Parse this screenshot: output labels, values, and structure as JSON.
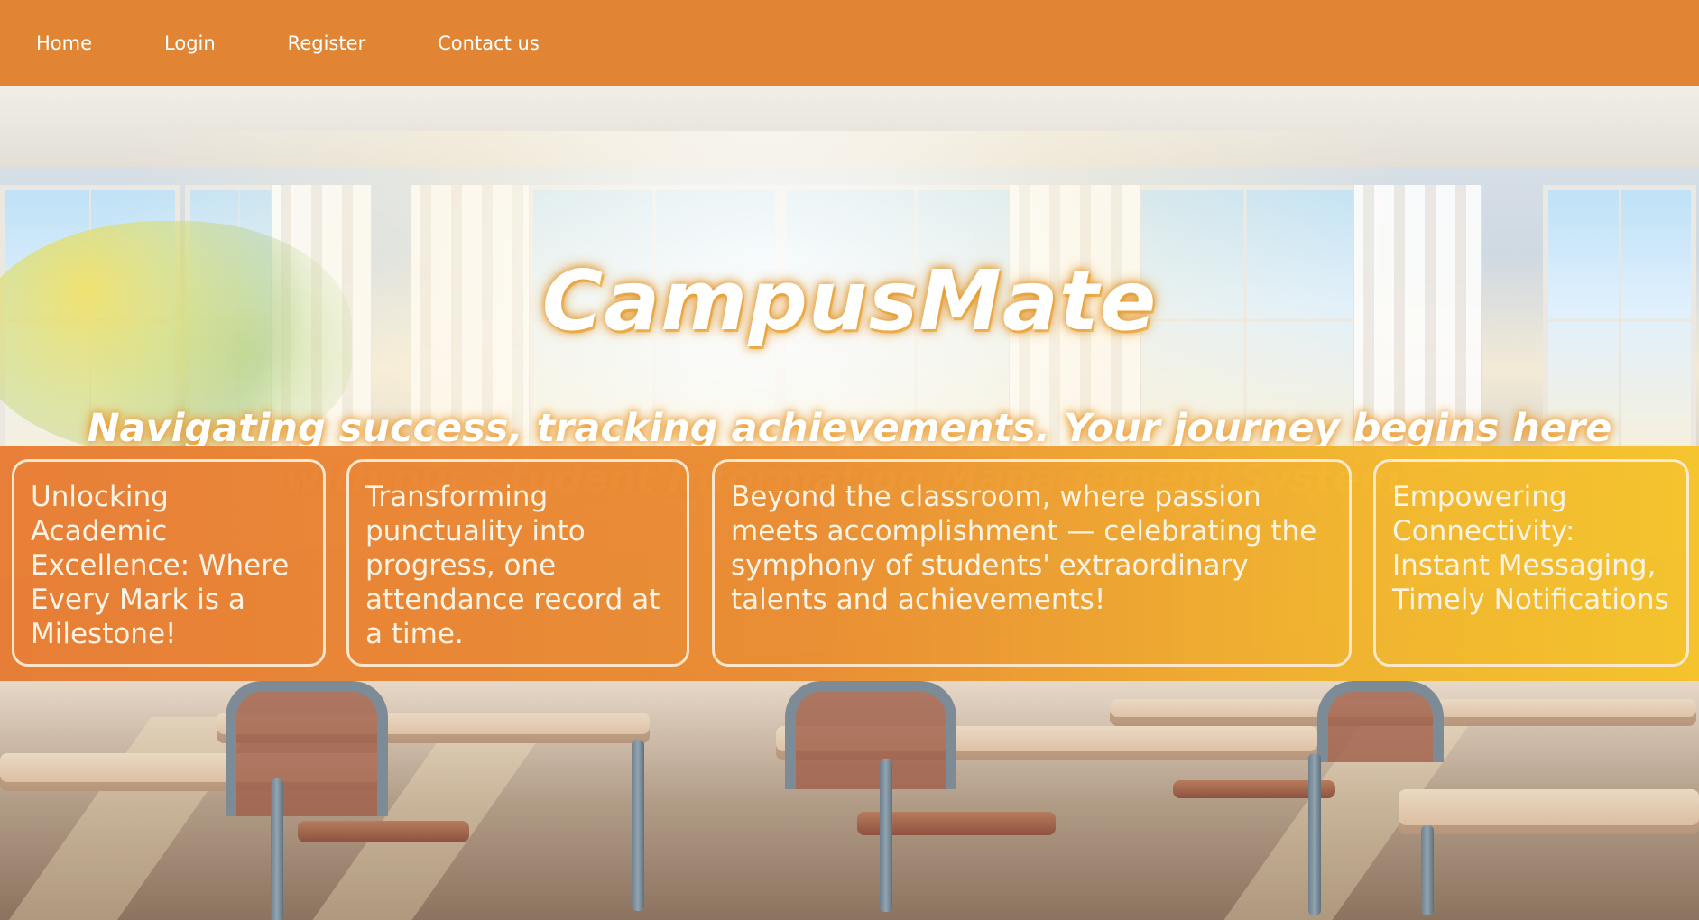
{
  "nav": {
    "items": [
      "Home",
      "Login",
      "Register",
      "Contact us"
    ]
  },
  "hero": {
    "title": "CampusMate",
    "tagline": "Navigating success, tracking achievements. Your journey begins here with our Student Information Management System."
  },
  "features": [
    "Unlocking Academic Excellence: Where Every Mark is a Milestone!",
    "Transforming punctuality into progress, one attendance record at a time.",
    "Beyond the classroom, where passion meets accomplishment — celebrating the symphony of students' extraordinary talents and achievements!",
    "Empowering Connectivity: Instant Messaging, Timely Notifications"
  ],
  "colors": {
    "nav_bg": "#e18534",
    "band_start": "#e97d34",
    "band_end": "#f6c42a",
    "text_white": "#ffffff"
  }
}
